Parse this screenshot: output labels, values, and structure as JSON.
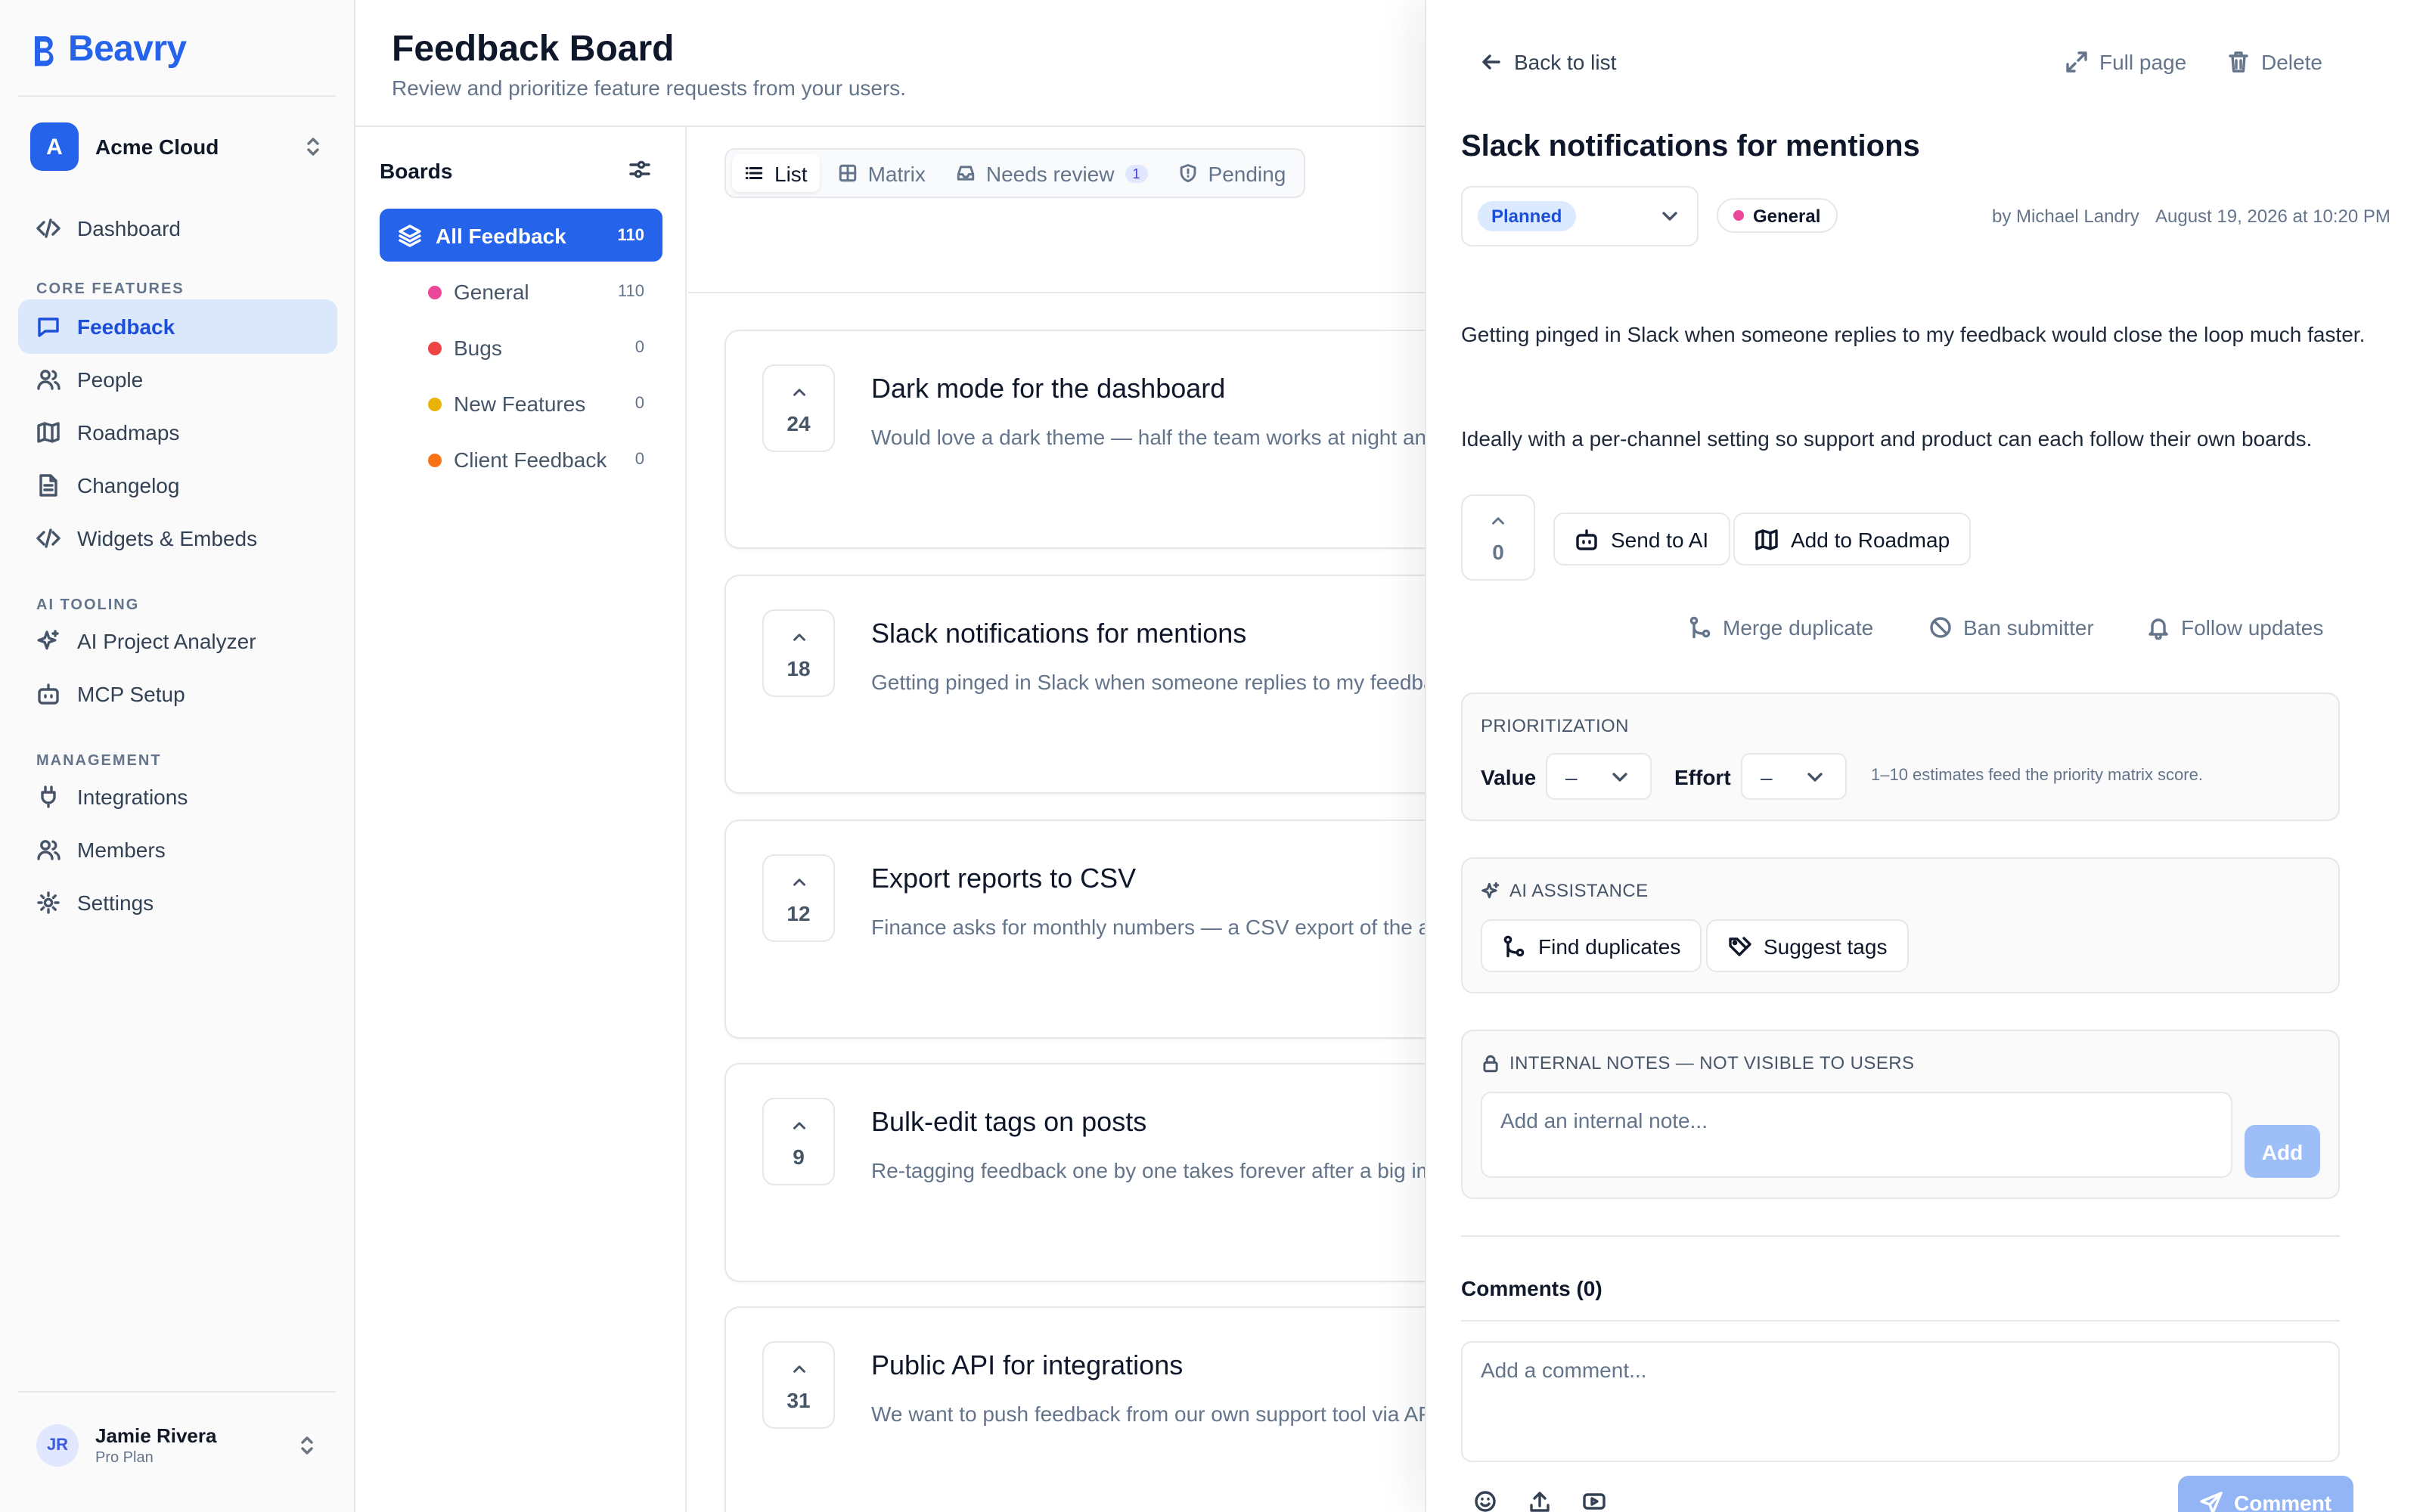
{
  "brand": {
    "name": "Beavry"
  },
  "workspace": {
    "initial": "A",
    "name": "Acme Cloud"
  },
  "nav": {
    "dashboard": "Dashboard",
    "section_core": "CORE FEATURES",
    "feedback": "Feedback",
    "people": "People",
    "roadmaps": "Roadmaps",
    "changelog": "Changelog",
    "widgets": "Widgets & Embeds",
    "section_ai": "AI TOOLING",
    "ai_analyzer": "AI Project Analyzer",
    "mcp": "MCP Setup",
    "section_mgmt": "MANAGEMENT",
    "integrations": "Integrations",
    "members": "Members",
    "settings": "Settings"
  },
  "user": {
    "initials": "JR",
    "name": "Jamie Rivera",
    "plan": "Pro Plan"
  },
  "header": {
    "title": "Feedback Board",
    "subtitle": "Review and prioritize feature requests from your users."
  },
  "boards": {
    "title": "Boards",
    "all": {
      "label": "All Feedback",
      "count": "110"
    },
    "items": [
      {
        "label": "General",
        "count": "110",
        "color": "#ec4899"
      },
      {
        "label": "Bugs",
        "count": "0",
        "color": "#ef4444"
      },
      {
        "label": "New Features",
        "count": "0",
        "color": "#eab308"
      },
      {
        "label": "Client Feedback",
        "count": "0",
        "color": "#f97316"
      }
    ]
  },
  "tabs": {
    "list": "List",
    "matrix": "Matrix",
    "needs_review": "Needs review",
    "needs_review_count": "1",
    "pending": "Pending"
  },
  "posts": [
    {
      "votes": "24",
      "title": "Dark mode for the dashboard",
      "desc": "Would love a dark theme — half the team works at night and"
    },
    {
      "votes": "18",
      "title": "Slack notifications for mentions",
      "desc": "Getting pinged in Slack when someone replies to my feedback"
    },
    {
      "votes": "12",
      "title": "Export reports to CSV",
      "desc": "Finance asks for monthly numbers — a CSV export of the ana"
    },
    {
      "votes": "9",
      "title": "Bulk-edit tags on posts",
      "desc": "Re-tagging feedback one by one takes forever after a big imp"
    },
    {
      "votes": "31",
      "title": "Public API for integrations",
      "desc": "We want to push feedback from our own support tool via API"
    }
  ],
  "detail": {
    "back": "Back to list",
    "full_page": "Full page",
    "delete": "Delete",
    "title": "Slack notifications for mentions",
    "status": "Planned",
    "board": "General",
    "author": "by Michael Landry",
    "date": "August 19, 2026 at 10:20 PM",
    "body_p1": "Getting pinged in Slack when someone replies to my feedback would close the loop much faster.",
    "body_p2": "Ideally with a per-channel setting so support and product can each follow their own boards.",
    "votes": "0",
    "send_ai": "Send to AI",
    "add_roadmap": "Add to Roadmap",
    "merge": "Merge duplicate",
    "ban": "Ban submitter",
    "follow": "Follow updates",
    "prioritization": {
      "label": "PRIORITIZATION",
      "value_label": "Value",
      "value": "–",
      "effort_label": "Effort",
      "effort": "–",
      "hint": "1–10 estimates feed the priority matrix score."
    },
    "ai": {
      "label": "AI ASSISTANCE",
      "find_duplicates": "Find duplicates",
      "suggest_tags": "Suggest tags"
    },
    "notes": {
      "label": "INTERNAL NOTES — NOT VISIBLE TO USERS",
      "placeholder": "Add an internal note...",
      "add": "Add"
    },
    "comments": {
      "title": "Comments (0)",
      "placeholder": "Add a comment...",
      "submit": "Comment"
    }
  },
  "colors": {
    "accent": "#2563eb",
    "active_nav_bg": "#dbe7fb"
  }
}
